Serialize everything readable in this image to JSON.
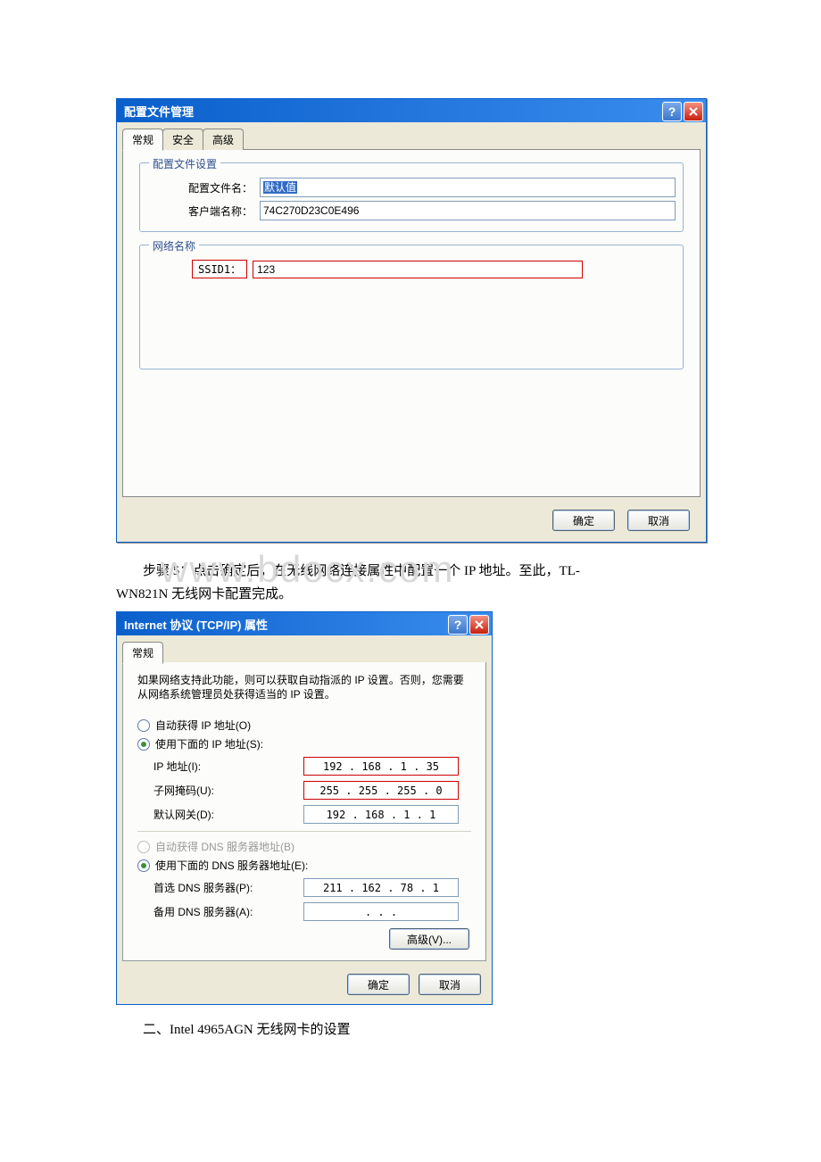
{
  "dialog1": {
    "title": "配置文件管理",
    "tabs": {
      "general": "常规",
      "security": "安全",
      "advanced": "高级"
    },
    "fs1": {
      "legend": "配置文件设置",
      "profile_label": "配置文件名：",
      "profile_value": "默认值",
      "client_label": "客户端名称：",
      "client_value": "74C270D23C0E496"
    },
    "fs2": {
      "legend": "网络名称",
      "ssid_label": "SSID1：",
      "ssid_value": "123"
    },
    "buttons": {
      "ok": "确定",
      "cancel": "取消"
    }
  },
  "bodytext": {
    "step5_a": "步骤 5：点击确定后，在无线网络连接属性中配置一个 IP 地址。至此，TL-",
    "step5_b": "WN821N 无线网卡配置完成。",
    "section2": "二、Intel 4965AGN 无线网卡的设置"
  },
  "watermark": "www.bdocx.com",
  "dialog2": {
    "title": "Internet 协议 (TCP/IP) 属性",
    "tab_general": "常规",
    "help": "如果网络支持此功能，则可以获取自动指派的 IP 设置。否则，您需要从网络系统管理员处获得适当的 IP 设置。",
    "radio_auto_ip": "自动获得 IP 地址(O)",
    "radio_use_ip": "使用下面的 IP 地址(S):",
    "ip_label": "IP 地址(I):",
    "ip_value": "192 . 168 .  1  .  35",
    "mask_label": "子网掩码(U):",
    "mask_value": "255 . 255 . 255 .  0",
    "gw_label": "默认网关(D):",
    "gw_value": "192 . 168 .  1  .  1",
    "radio_auto_dns": "自动获得 DNS 服务器地址(B)",
    "radio_use_dns": "使用下面的 DNS 服务器地址(E):",
    "dns1_label": "首选 DNS 服务器(P):",
    "dns1_value": "211 . 162 .  78 .  1",
    "dns2_label": "备用 DNS 服务器(A):",
    "dns2_value": "    .     .     .    ",
    "advanced_btn": "高级(V)...",
    "buttons": {
      "ok": "确定",
      "cancel": "取消"
    }
  }
}
